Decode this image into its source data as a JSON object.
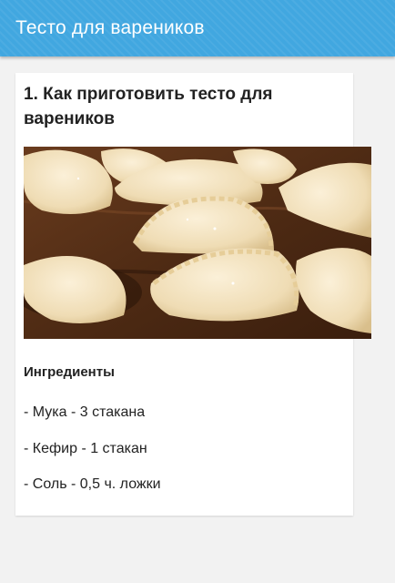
{
  "app": {
    "title": "Тесто для вареников"
  },
  "recipe": {
    "title": "1. Как приготовить тесто для вареников",
    "image_alt": "dumplings-photo",
    "ingredients_heading": "Ингредиенты",
    "ingredients": [
      "- Мука - 3 стакана",
      "- Кефир - 1 стакан",
      "- Соль - 0,5 ч. ложки"
    ]
  },
  "colors": {
    "appbar": "#41a7e0",
    "background": "#f2f2f2",
    "card": "#ffffff"
  }
}
